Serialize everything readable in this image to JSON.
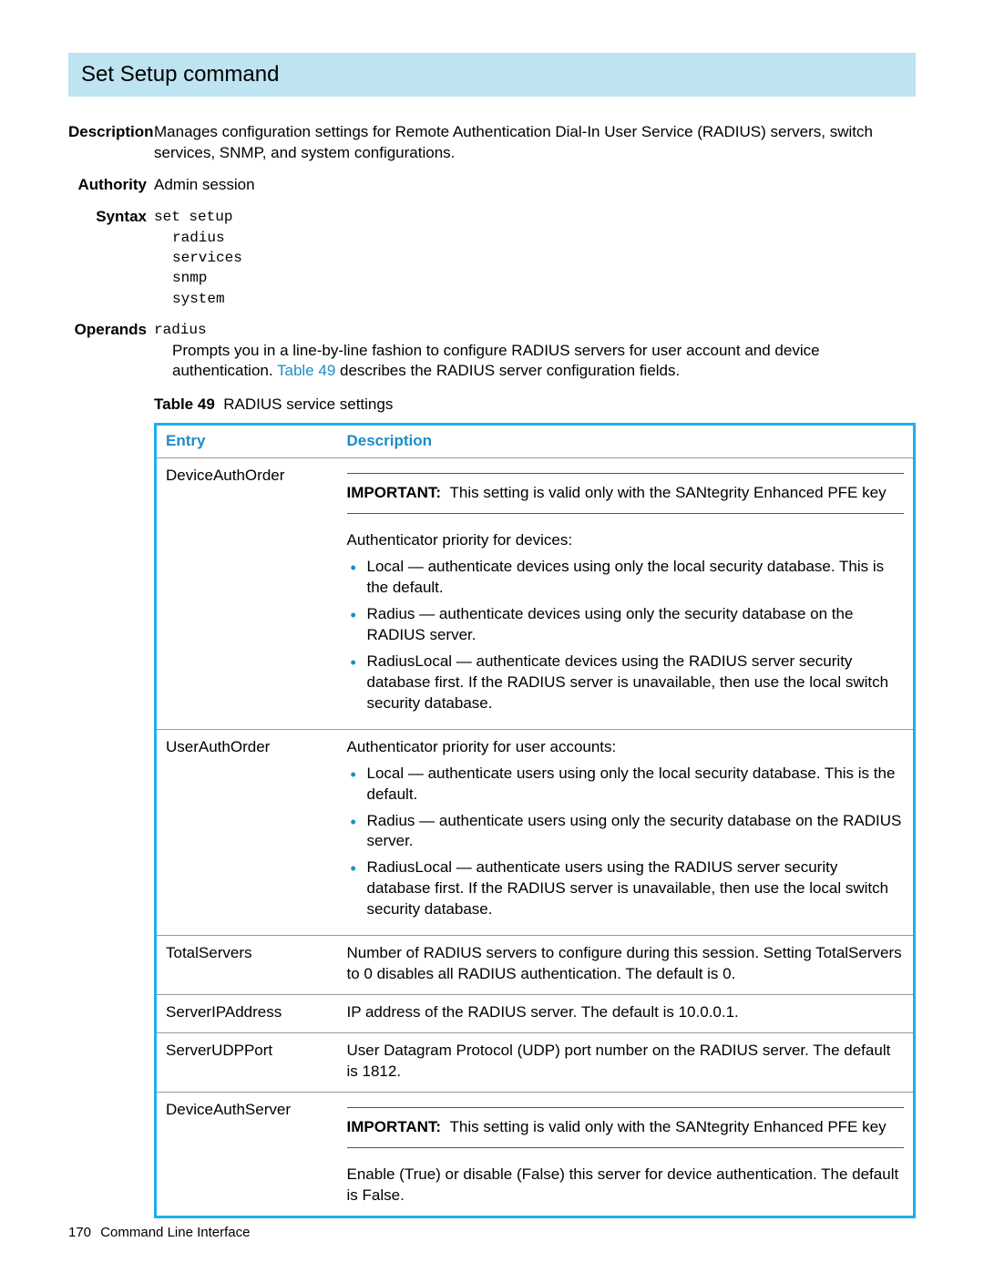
{
  "title": "Set Setup command",
  "labels": {
    "description": "Description",
    "authority": "Authority",
    "syntax": "Syntax",
    "operands": "Operands"
  },
  "description_text": "Manages configuration settings for Remote Authentication Dial-In User Service (RADIUS) servers, switch services, SNMP, and system configurations.",
  "authority_text": "Admin session",
  "syntax_lines": {
    "l0": "set setup",
    "l1": "radius",
    "l2": "services",
    "l3": "snmp",
    "l4": "system"
  },
  "operands": {
    "keyword": "radius",
    "intro_pre": "Prompts you in a line-by-line fashion to configure RADIUS servers for user account and device authentication. ",
    "intro_link": "Table 49",
    "intro_post": " describes the RADIUS server configuration fields."
  },
  "table_caption": {
    "label": "Table 49",
    "text": "RADIUS service settings"
  },
  "table_headers": {
    "entry": "Entry",
    "description": "Description"
  },
  "rows": {
    "deviceAuthOrder": {
      "entry": "DeviceAuthOrder",
      "important_label": "IMPORTANT:",
      "important_text": "This setting is valid only with the SANtegrity Enhanced PFE key",
      "intro": "Authenticator priority for devices:",
      "b1": "Local — authenticate devices using only the local security database. This is the default.",
      "b2": "Radius — authenticate devices using only the security database on the RADIUS server.",
      "b3": "RadiusLocal — authenticate devices using the RADIUS server security database first. If the RADIUS server is unavailable, then use the local switch security database."
    },
    "userAuthOrder": {
      "entry": "UserAuthOrder",
      "intro": "Authenticator priority for user accounts:",
      "b1": "Local — authenticate users using only the local security database. This is the default.",
      "b2": "Radius — authenticate users using only the security database on the RADIUS server.",
      "b3": "RadiusLocal — authenticate users using the RADIUS server security database first. If the RADIUS server is unavailable, then use the local switch security database."
    },
    "totalServers": {
      "entry": "TotalServers",
      "text": "Number of RADIUS servers to configure during this session. Setting TotalServers to 0 disables all RADIUS authentication. The default is 0."
    },
    "serverIP": {
      "entry": "ServerIPAddress",
      "text": "IP address of the RADIUS server. The default is 10.0.0.1."
    },
    "serverUDP": {
      "entry": "ServerUDPPort",
      "text": "User Datagram Protocol (UDP) port number on the RADIUS server. The default is 1812."
    },
    "deviceAuthServer": {
      "entry": "DeviceAuthServer",
      "important_label": "IMPORTANT:",
      "important_text": "This setting is valid only with the SANtegrity Enhanced PFE key",
      "text": "Enable (True) or disable (False) this server for device authentication. The default is False."
    }
  },
  "footer": {
    "page": "170",
    "text": "Command Line Interface"
  }
}
